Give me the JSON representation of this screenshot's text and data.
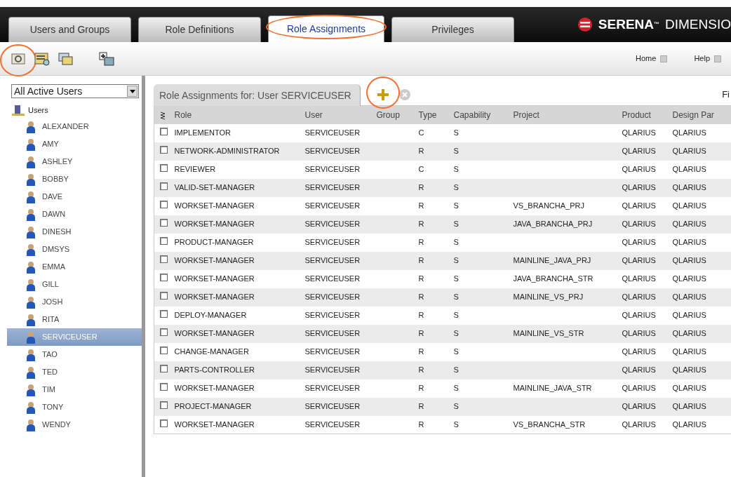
{
  "tabs": [
    {
      "label": "Users and Groups",
      "selected": false,
      "highlighted": false
    },
    {
      "label": "Role Definitions",
      "selected": false,
      "highlighted": false
    },
    {
      "label": "Role Assignments",
      "selected": true,
      "highlighted": true
    },
    {
      "label": "Privileges",
      "selected": false,
      "highlighted": false
    }
  ],
  "brand": {
    "name": "SERENA",
    "mark": "™",
    "product": "DIMENSIO"
  },
  "toolbar": {
    "icons": [
      {
        "kind": "assign",
        "highlighted": true
      },
      {
        "kind": "find",
        "highlighted": false
      },
      {
        "kind": "browse",
        "highlighted": false
      },
      {
        "kind": "add",
        "highlighted": false
      }
    ],
    "links": [
      "Home",
      "Help"
    ]
  },
  "sidebar": {
    "filter": "All Active Users",
    "root": "Users",
    "items": [
      {
        "label": "ALEXANDER",
        "selected": false
      },
      {
        "label": "AMY",
        "selected": false
      },
      {
        "label": "ASHLEY",
        "selected": false
      },
      {
        "label": "BOBBY",
        "selected": false
      },
      {
        "label": "DAVE",
        "selected": false
      },
      {
        "label": "DAWN",
        "selected": false
      },
      {
        "label": "DINESH",
        "selected": false
      },
      {
        "label": "DMSYS",
        "selected": false
      },
      {
        "label": "EMMA",
        "selected": false
      },
      {
        "label": "GILL",
        "selected": false
      },
      {
        "label": "JOSH",
        "selected": false
      },
      {
        "label": "RITA",
        "selected": false
      },
      {
        "label": "SERVICEUSER",
        "selected": true
      },
      {
        "label": "TAO",
        "selected": false
      },
      {
        "label": "TED",
        "selected": false
      },
      {
        "label": "TIM",
        "selected": false
      },
      {
        "label": "TONY",
        "selected": false
      },
      {
        "label": "WENDY",
        "selected": false
      }
    ]
  },
  "panel": {
    "title": "Role Assignments for:  User SERVICEUSER",
    "add_highlighted": true,
    "cut_label": "Fi",
    "columns": [
      "Role",
      "User",
      "Group",
      "Type",
      "Capability",
      "Project",
      "Product",
      "Design Par"
    ],
    "rows": [
      {
        "checked": false,
        "cells": [
          "IMPLEMENTOR",
          "SERVICEUSER",
          "",
          "C",
          "S",
          "",
          "QLARIUS",
          "QLARIUS"
        ]
      },
      {
        "checked": false,
        "cells": [
          "NETWORK-ADMINISTRATOR",
          "SERVICEUSER",
          "",
          "R",
          "S",
          "",
          "QLARIUS",
          "QLARIUS"
        ]
      },
      {
        "checked": false,
        "cells": [
          "REVIEWER",
          "SERVICEUSER",
          "",
          "C",
          "S",
          "",
          "QLARIUS",
          "QLARIUS"
        ]
      },
      {
        "checked": false,
        "cells": [
          "VALID-SET-MANAGER",
          "SERVICEUSER",
          "",
          "R",
          "S",
          "",
          "QLARIUS",
          "QLARIUS"
        ]
      },
      {
        "checked": false,
        "cells": [
          "WORKSET-MANAGER",
          "SERVICEUSER",
          "",
          "R",
          "S",
          "VS_BRANCHA_PRJ",
          "QLARIUS",
          "QLARIUS"
        ]
      },
      {
        "checked": false,
        "cells": [
          "WORKSET-MANAGER",
          "SERVICEUSER",
          "",
          "R",
          "S",
          "JAVA_BRANCHA_PRJ",
          "QLARIUS",
          "QLARIUS"
        ]
      },
      {
        "checked": false,
        "cells": [
          "PRODUCT-MANAGER",
          "SERVICEUSER",
          "",
          "R",
          "S",
          "",
          "QLARIUS",
          "QLARIUS"
        ]
      },
      {
        "checked": false,
        "cells": [
          "WORKSET-MANAGER",
          "SERVICEUSER",
          "",
          "R",
          "S",
          "MAINLINE_JAVA_PRJ",
          "QLARIUS",
          "QLARIUS"
        ]
      },
      {
        "checked": false,
        "cells": [
          "WORKSET-MANAGER",
          "SERVICEUSER",
          "",
          "R",
          "S",
          "JAVA_BRANCHA_STR",
          "QLARIUS",
          "QLARIUS"
        ]
      },
      {
        "checked": false,
        "cells": [
          "WORKSET-MANAGER",
          "SERVICEUSER",
          "",
          "R",
          "S",
          "MAINLINE_VS_PRJ",
          "QLARIUS",
          "QLARIUS"
        ]
      },
      {
        "checked": false,
        "cells": [
          "DEPLOY-MANAGER",
          "SERVICEUSER",
          "",
          "R",
          "S",
          "",
          "QLARIUS",
          "QLARIUS"
        ]
      },
      {
        "checked": false,
        "cells": [
          "WORKSET-MANAGER",
          "SERVICEUSER",
          "",
          "R",
          "S",
          "MAINLINE_VS_STR",
          "QLARIUS",
          "QLARIUS"
        ]
      },
      {
        "checked": false,
        "cells": [
          "CHANGE-MANAGER",
          "SERVICEUSER",
          "",
          "R",
          "S",
          "",
          "QLARIUS",
          "QLARIUS"
        ]
      },
      {
        "checked": false,
        "cells": [
          "PARTS-CONTROLLER",
          "SERVICEUSER",
          "",
          "R",
          "S",
          "",
          "QLARIUS",
          "QLARIUS"
        ]
      },
      {
        "checked": false,
        "cells": [
          "WORKSET-MANAGER",
          "SERVICEUSER",
          "",
          "R",
          "S",
          "MAINLINE_JAVA_STR",
          "QLARIUS",
          "QLARIUS"
        ]
      },
      {
        "checked": false,
        "cells": [
          "PROJECT-MANAGER",
          "SERVICEUSER",
          "",
          "R",
          "S",
          "",
          "QLARIUS",
          "QLARIUS"
        ]
      },
      {
        "checked": false,
        "cells": [
          "WORKSET-MANAGER",
          "SERVICEUSER",
          "",
          "R",
          "S",
          "VS_BRANCHA_STR",
          "QLARIUS",
          "QLARIUS"
        ]
      }
    ]
  }
}
